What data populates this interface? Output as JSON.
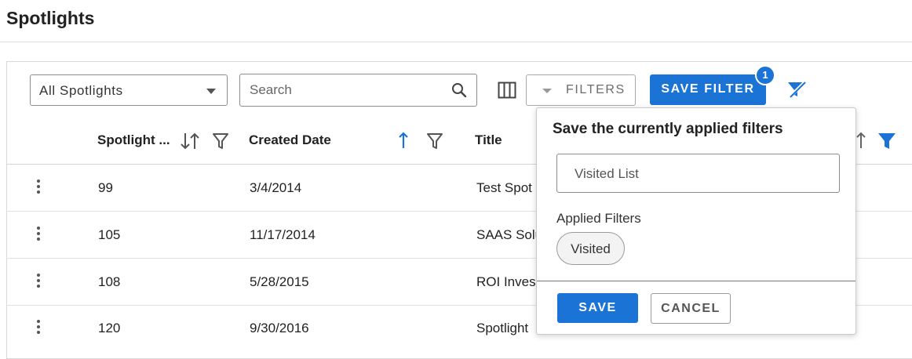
{
  "page": {
    "title": "Spotlights"
  },
  "toolbar": {
    "view_select_value": "All Spotlights",
    "search_placeholder": "Search",
    "filters_label": "FILTERS",
    "save_filter_label": "SAVE FILTER",
    "save_filter_badge": "1"
  },
  "table": {
    "columns": [
      "Spotlight ...",
      "Created Date",
      "Title"
    ],
    "rows": [
      {
        "id": "99",
        "date": "3/4/2014",
        "title": "Test Spot"
      },
      {
        "id": "105",
        "date": "11/17/2014",
        "title": "SAAS Solu"
      },
      {
        "id": "108",
        "date": "5/28/2015",
        "title": "ROI Inves"
      },
      {
        "id": "120",
        "date": "9/30/2016",
        "title": "Spotlight"
      }
    ]
  },
  "popover": {
    "heading": "Save the currently applied filters",
    "name_value": "Visited List",
    "applied_label": "Applied Filters",
    "chips": [
      "Visited"
    ],
    "save_label": "SAVE",
    "cancel_label": "CANCEL"
  },
  "colors": {
    "primary": "#1b73d6",
    "text": "#222222",
    "border": "#8c8c8c"
  },
  "icons": {
    "view_select": "chevron-down-icon",
    "search": "search-icon",
    "columns": "columns-icon",
    "filters": "caret-down-icon",
    "clear_filters": "filter-clear-icon",
    "sort_both": "sort-icon",
    "sort_asc": "sort-ascending-icon",
    "filter": "filter-icon",
    "filter_active": "filter-active-icon",
    "row_menu": "kebab-menu-icon"
  }
}
